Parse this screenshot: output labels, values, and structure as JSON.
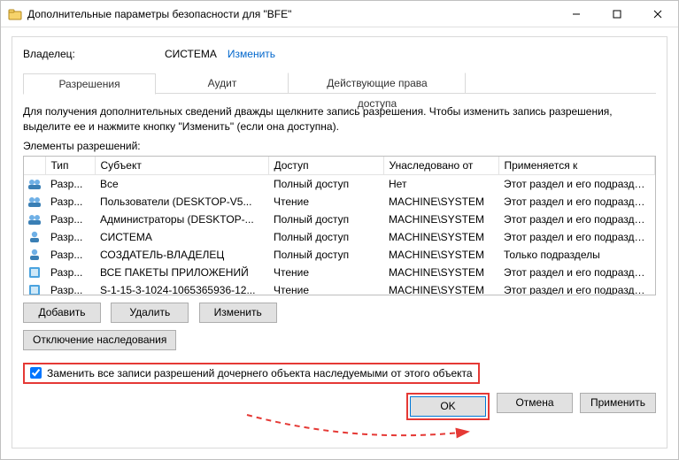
{
  "window": {
    "title": "Дополнительные параметры безопасности  для \"BFE\""
  },
  "owner": {
    "label": "Владелец:",
    "value": "СИСТЕМА",
    "change_link": "Изменить"
  },
  "tabs": {
    "permissions": "Разрешения",
    "audit": "Аудит",
    "effective": "Действующие права доступа"
  },
  "description": "Для получения дополнительных сведений дважды щелкните запись разрешения. Чтобы изменить запись разрешения, выделите ее и нажмите кнопку \"Изменить\" (если она доступна).",
  "entries_label": "Элементы разрешений:",
  "columns": {
    "type": "Тип",
    "principal": "Субъект",
    "access": "Доступ",
    "inherited": "Унаследовано от",
    "applies": "Применяется к"
  },
  "rows": [
    {
      "icon": "group",
      "type": "Разр...",
      "principal": "Все",
      "access": "Полный доступ",
      "inherited": "Нет",
      "applies": "Этот раздел и его подразделы"
    },
    {
      "icon": "group",
      "type": "Разр...",
      "principal": "Пользователи (DESKTOP-V5...",
      "access": "Чтение",
      "inherited": "MACHINE\\SYSTEM",
      "applies": "Этот раздел и его подразделы"
    },
    {
      "icon": "group",
      "type": "Разр...",
      "principal": "Администраторы (DESKTOP-...",
      "access": "Полный доступ",
      "inherited": "MACHINE\\SYSTEM",
      "applies": "Этот раздел и его подразделы"
    },
    {
      "icon": "user",
      "type": "Разр...",
      "principal": "СИСТЕМА",
      "access": "Полный доступ",
      "inherited": "MACHINE\\SYSTEM",
      "applies": "Этот раздел и его подразделы"
    },
    {
      "icon": "user",
      "type": "Разр...",
      "principal": "СОЗДАТЕЛЬ-ВЛАДЕЛЕЦ",
      "access": "Полный доступ",
      "inherited": "MACHINE\\SYSTEM",
      "applies": "Только подразделы"
    },
    {
      "icon": "pkg",
      "type": "Разр...",
      "principal": "ВСЕ ПАКЕТЫ ПРИЛОЖЕНИЙ",
      "access": "Чтение",
      "inherited": "MACHINE\\SYSTEM",
      "applies": "Этот раздел и его подразделы"
    },
    {
      "icon": "pkg",
      "type": "Разр...",
      "principal": "S-1-15-3-1024-1065365936-12...",
      "access": "Чтение",
      "inherited": "MACHINE\\SYSTEM",
      "applies": "Этот раздел и его подразделы"
    }
  ],
  "buttons": {
    "add": "Добавить",
    "remove": "Удалить",
    "edit": "Изменить",
    "disable_inh": "Отключение наследования",
    "ok": "OK",
    "cancel": "Отмена",
    "apply": "Применить"
  },
  "replace_checkbox": {
    "checked": true,
    "label": "Заменить все записи разрешений дочернего объекта наследуемыми от этого объекта"
  }
}
